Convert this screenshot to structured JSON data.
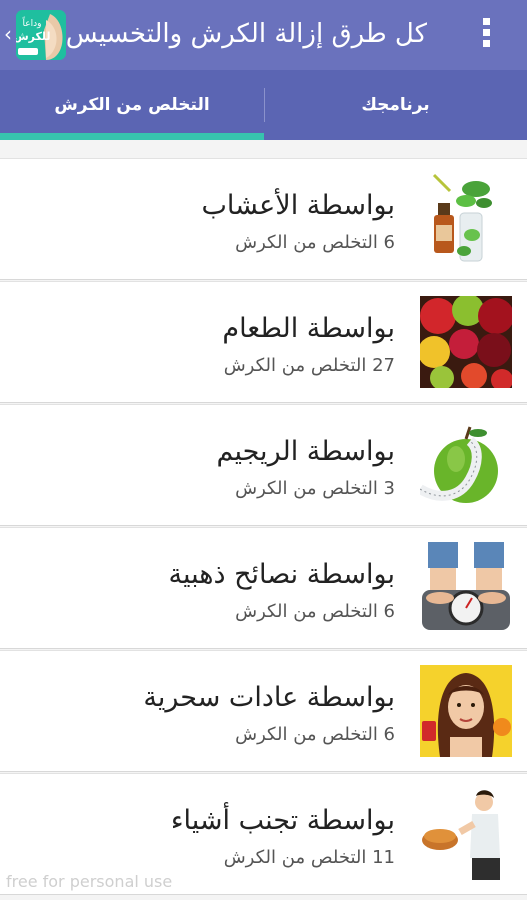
{
  "app_bar": {
    "title": "كل طرق إزالة الكرش والتخسيس",
    "back_glyph": "‹",
    "logo_text_top": "وداعاً",
    "logo_text_bottom": "للكرش"
  },
  "tabs": [
    {
      "label": "التخلص من الكرش",
      "selected": true
    },
    {
      "label": "برنامجك",
      "selected": false
    }
  ],
  "items": [
    {
      "title": "بواسطة الأعشاب",
      "subtitle": "6 التخلص من الكرش",
      "icon": "herbs-bottle-image"
    },
    {
      "title": "بواسطة الطعام",
      "subtitle": "27 التخلص من الكرش",
      "icon": "fruits-image"
    },
    {
      "title": "بواسطة الريجيم",
      "subtitle": "3 التخلص من الكرش",
      "icon": "apple-measuring-tape-image"
    },
    {
      "title": "بواسطة نصائح ذهبية",
      "subtitle": "6 التخلص من الكرش",
      "icon": "bathroom-scale-image"
    },
    {
      "title": "بواسطة عادات سحرية",
      "subtitle": "6 التخلص من الكرش",
      "icon": "woman-choosing-food-image"
    },
    {
      "title": "بواسطة تجنب أشياء",
      "subtitle": "11 التخلص من الكرش",
      "icon": "woman-refusing-bread-image"
    }
  ],
  "watermark": "free for personal use",
  "colors": {
    "app_bar": "#6a72bd",
    "tab_bar": "#5b65b3",
    "indicator": "#37c4ae"
  }
}
